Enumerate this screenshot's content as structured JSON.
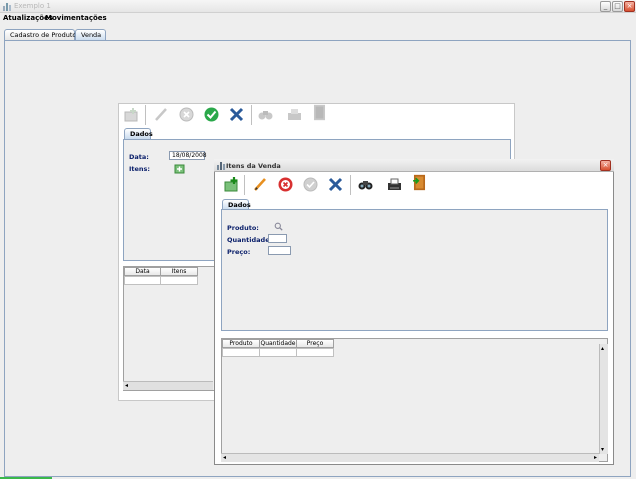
{
  "window": {
    "title": "Exemplo 1"
  },
  "menu": [
    "Atualizações",
    "Movimentações"
  ],
  "main_tabs": [
    "Cadastro de Produto",
    "Venda"
  ],
  "venda": {
    "tab": "Dados",
    "data_label": "Data:",
    "data_value": "18/08/2008",
    "itens_label": "Itens:",
    "table_headers": [
      "Data",
      "Itens"
    ]
  },
  "itens_venda": {
    "title": "Itens da Venda",
    "tab": "Dados",
    "produto_label": "Produto:",
    "quantidade_label": "Quantidade:",
    "preco_label": "Preço:",
    "table_headers": [
      "Produto",
      "Quantidade",
      "Preço"
    ]
  },
  "colors": {
    "label_blue": "#0a1f6a",
    "tab_border": "#8ea4c0"
  }
}
